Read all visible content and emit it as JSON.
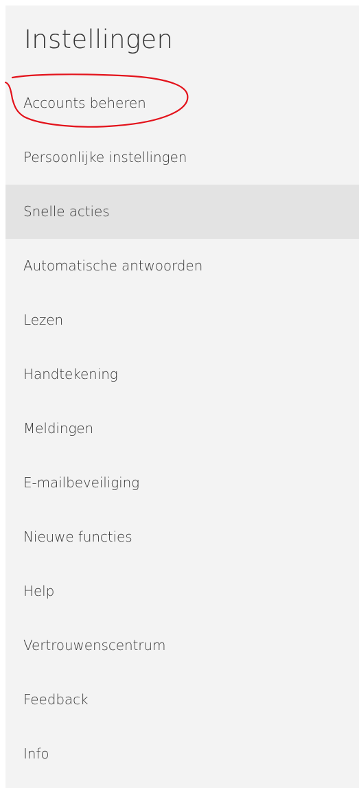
{
  "settings": {
    "title": "Instellingen",
    "items": [
      {
        "label": "Accounts beheren"
      },
      {
        "label": "Persoonlijke instellingen"
      },
      {
        "label": "Snelle acties"
      },
      {
        "label": "Automatische antwoorden"
      },
      {
        "label": "Lezen"
      },
      {
        "label": "Handtekening"
      },
      {
        "label": "Meldingen"
      },
      {
        "label": "E-mailbeveiliging"
      },
      {
        "label": "Nieuwe functies"
      },
      {
        "label": "Help"
      },
      {
        "label": "Vertrouwenscentrum"
      },
      {
        "label": "Feedback"
      },
      {
        "label": "Info"
      }
    ],
    "selected_item": "Snelle acties",
    "highlighted_item": "Accounts beheren"
  },
  "colors": {
    "panel_background": "#f3f3f3",
    "selected_background": "#e3e3e3",
    "text": "#3a3a3a",
    "annotation_stroke": "#e3121b"
  }
}
